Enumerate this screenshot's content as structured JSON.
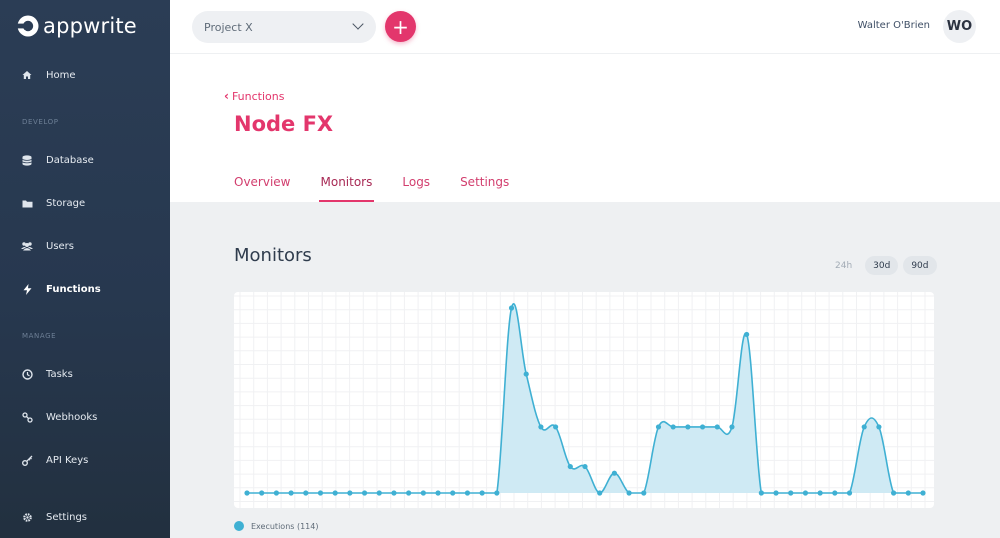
{
  "app": {
    "logo_text": "appwrite"
  },
  "sidebar": {
    "items": [
      {
        "label": "Home",
        "icon": "home-icon"
      },
      {
        "section": "DEVELOP"
      },
      {
        "label": "Database",
        "icon": "database-icon"
      },
      {
        "label": "Storage",
        "icon": "storage-icon"
      },
      {
        "label": "Users",
        "icon": "users-icon"
      },
      {
        "label": "Functions",
        "icon": "bolt-icon",
        "active": true
      },
      {
        "section": "MANAGE"
      },
      {
        "label": "Tasks",
        "icon": "clock-icon"
      },
      {
        "label": "Webhooks",
        "icon": "webhook-icon"
      },
      {
        "label": "API Keys",
        "icon": "key-icon"
      },
      {
        "label": "Settings",
        "icon": "gear-icon"
      }
    ]
  },
  "topbar": {
    "project": "Project X",
    "add_label": "+",
    "user_name": "Walter O'Brien",
    "avatar_initials": "WO"
  },
  "header": {
    "back_label": "Functions",
    "title": "Node FX",
    "tabs": [
      "Overview",
      "Monitors",
      "Logs",
      "Settings"
    ],
    "active_tab": "Monitors"
  },
  "monitors": {
    "title": "Monitors",
    "ranges": [
      "24h",
      "30d",
      "90d"
    ],
    "selected_range": "30d",
    "legend_label": "Executions (114)"
  },
  "colors": {
    "accent": "#e3366c",
    "series": "#3fb0d3",
    "series_fill": "#cfeaf4",
    "sidebar": "#2b3d55"
  },
  "chart_data": {
    "type": "area",
    "title": "",
    "xlabel": "",
    "ylabel": "",
    "ylim": [
      0,
      14
    ],
    "grid": true,
    "series": [
      {
        "name": "Executions (114)",
        "values": [
          0,
          0,
          0,
          0,
          0,
          0,
          0,
          0,
          0,
          0,
          0,
          0,
          0,
          0,
          0,
          0,
          0,
          0,
          14,
          9,
          5,
          5,
          2,
          2,
          0,
          1.5,
          0,
          0,
          5,
          5,
          5,
          5,
          5,
          5,
          12,
          0,
          0,
          0,
          0,
          0,
          0,
          0,
          5,
          5,
          0,
          0,
          0
        ]
      }
    ]
  }
}
